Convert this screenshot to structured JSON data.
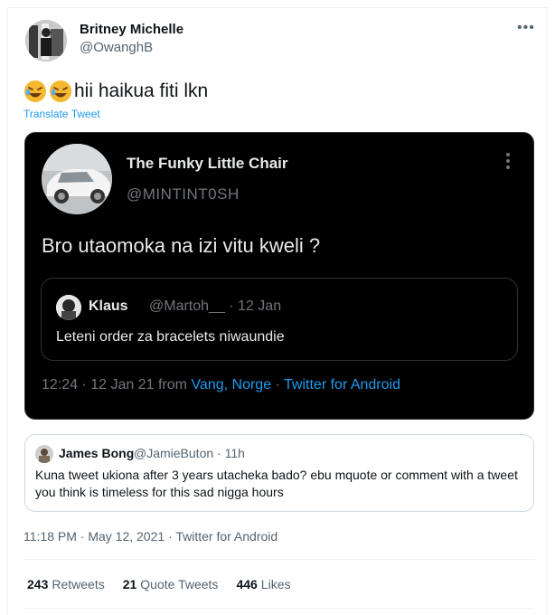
{
  "author": {
    "name": "Britney Michelle",
    "handle": "@OwanghB"
  },
  "tweet": {
    "text": "hii haikua fiti lkn",
    "translate_label": "Translate Tweet",
    "meta": "11:18 PM · May 12, 2021 · Twitter for Android"
  },
  "embedded_tweet": {
    "name": "The Funky Little Chair",
    "handle": "@MINTINT0SH",
    "text": "Bro utaomoka na izi vitu kweli ?",
    "inner_quote": {
      "name": "Klaus",
      "handle_date": "@Martoh__ · 12 Jan",
      "text": "Leteni order za bracelets niwaundie"
    },
    "meta_time": "12:24 · 12 Jan 21 from ",
    "meta_location": "Vang, Norge",
    "meta_sep": " · ",
    "meta_source": "Twitter for Android"
  },
  "quoted_tweet": {
    "name": "James Bong",
    "handle_time": "@JamieButon · 11h",
    "text": "Kuna tweet ukiona after 3 years utacheka bado? ebu mquote or comment with a tweet you think is timeless for this sad nigga hours"
  },
  "stats": [
    {
      "count": "243",
      "label": "Retweets"
    },
    {
      "count": "21",
      "label": "Quote Tweets"
    },
    {
      "count": "446",
      "label": "Likes"
    }
  ],
  "icons": {
    "emoji": "rolling-on-floor-laughing-emoji",
    "more": "more-options-icon"
  }
}
